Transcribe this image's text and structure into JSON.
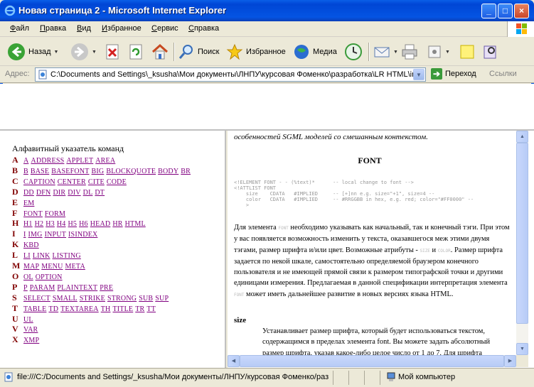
{
  "window": {
    "title": "Новая страница 2 - Microsoft Internet Explorer",
    "minimize": "_",
    "maximize": "□",
    "close": "×"
  },
  "menu": [
    "Файл",
    "Правка",
    "Вид",
    "Избранное",
    "Сервис",
    "Справка"
  ],
  "toolbar": {
    "back": "Назад",
    "search": "Поиск",
    "favorites": "Избранное",
    "media": "Медиа"
  },
  "address": {
    "label": "Адрес:",
    "value": "C:\\Documents and Settings\\_ksusha\\Мои документы\\ЛНПУ\\курсовая Фоменко\\разработка\\LR HTML\\in",
    "go": "Переход",
    "links": "Ссылки"
  },
  "left_frame": {
    "title": "Алфавитный указатель команд",
    "rows": [
      {
        "letter": "A",
        "tags": [
          "A",
          "ADDRESS",
          "APPLET",
          "AREA"
        ]
      },
      {
        "letter": "B",
        "tags": [
          "B",
          "BASE",
          "BASEFONT",
          "BIG",
          "BLOCKQUOTE",
          "BODY",
          "BR"
        ]
      },
      {
        "letter": "C",
        "tags": [
          "CAPTION",
          "CENTER",
          "CITE",
          "CODE"
        ]
      },
      {
        "letter": "D",
        "tags": [
          "DD",
          "DFN",
          "DIR",
          "DIV",
          "DL",
          "DT"
        ]
      },
      {
        "letter": "E",
        "tags": [
          "EM"
        ]
      },
      {
        "letter": "F",
        "tags": [
          "FONT",
          "FORM"
        ]
      },
      {
        "letter": "H",
        "tags": [
          "H1",
          "H2",
          "H3",
          "H4",
          "H5",
          "H6",
          "HEAD",
          "HR",
          "HTML"
        ]
      },
      {
        "letter": "I",
        "tags": [
          "I",
          "IMG",
          "INPUT",
          "ISINDEX"
        ]
      },
      {
        "letter": "K",
        "tags": [
          "KBD"
        ]
      },
      {
        "letter": "L",
        "tags": [
          "LI",
          "LINK",
          "LISTING"
        ]
      },
      {
        "letter": "M",
        "tags": [
          "MAP",
          "MENU",
          "META"
        ]
      },
      {
        "letter": "O",
        "tags": [
          "OL",
          "OPTION"
        ]
      },
      {
        "letter": "P",
        "tags": [
          "P",
          "PARAM",
          "PLAINTEXT",
          "PRE"
        ]
      },
      {
        "letter": "S",
        "tags": [
          "SELECT",
          "SMALL",
          "STRIKE",
          "STRONG",
          "SUB",
          "SUP"
        ]
      },
      {
        "letter": "T",
        "tags": [
          "TABLE",
          "TD",
          "TEXTAREA",
          "TH",
          "TITLE",
          "TR",
          "TT"
        ]
      },
      {
        "letter": "U",
        "tags": [
          "UL"
        ]
      },
      {
        "letter": "V",
        "tags": [
          "VAR"
        ]
      },
      {
        "letter": "X",
        "tags": [
          "XMP"
        ]
      }
    ]
  },
  "right_frame": {
    "top_line": "особенностей SGML моделей со смешанным контекстом.",
    "heading": "FONT",
    "code": "<!ELEMENT FONT - - (%text)*      -- local change to font -->\n<!ATTLIST FONT\n    size    CDATA   #IMPLIED     -- [+]nn e.g. size=\"+1\", size=4 --\n    color   CDATA   #IMPLIED     -- #RRGGBB in hex, e.g. red; color=\"#FF0000\" --\n    >",
    "para_1": "Для элемента ",
    "para_tag": "FONT",
    "para_2": " необходимо указывать как начальный, так и конечный тэги. При этом у вас появляется возможность изменить у текста, оказавшегося меж этими двумя тэгами, размер шрифта и/или цвет. Возможные атрибуты - ",
    "para_size": "SIZE",
    "para_and": " и ",
    "para_color": "COLOR",
    "para_3": ". Размер шрифта задается по некой шкале, самостоятельно определяемой браузером конечного пользователя и не имеющей прямой связи к размером типографской точки и другими единицами измерения. Предлагаемая в данной спецификации интерпретация элемента ",
    "para_tag2": "FONT",
    "para_4": " может иметь дальнейшее развитие в новых версиях языка HTML.",
    "size_term": "size",
    "size_def": "Устанавливает размер шрифта, который будет использоваться текстом, содержащимся в пределах элемента font. Вы можете задать абсолютный размер шрифта, указав какое-либо целое число от 1 до 7. Для шрифта"
  },
  "status": {
    "text": "file:///C:/Documents and Settings/_ksusha/Мои документы/ЛНПУ/курсовая Фоменко/раз",
    "zone": "Мой компьютер"
  },
  "colors": {
    "titlebar": "#0454e3",
    "visited_link": "#800080",
    "letter": "#800000"
  }
}
